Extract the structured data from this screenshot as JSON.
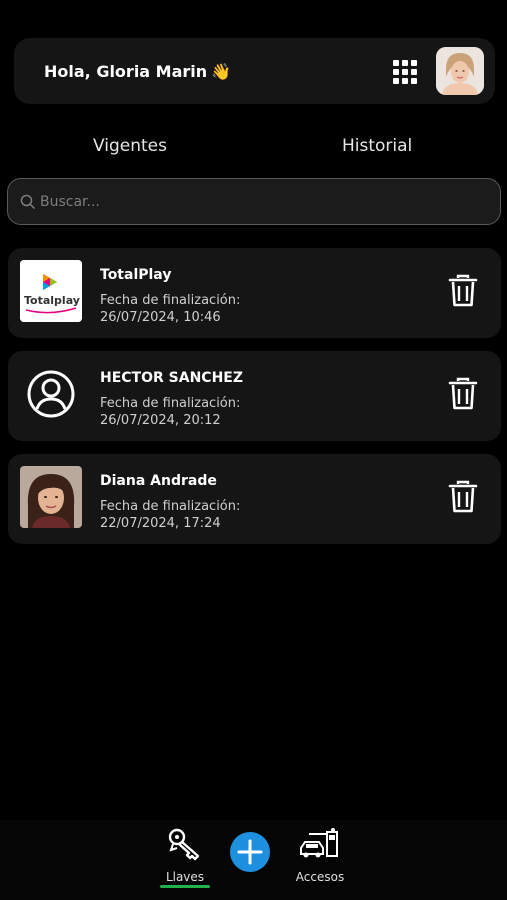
{
  "header": {
    "greeting": "Hola, Gloria Marin",
    "wave_emoji": "👋",
    "grid_icon": "apps-grid-icon",
    "avatar_icon": "user-avatar"
  },
  "tabs": [
    {
      "label": "Vigentes",
      "active": true
    },
    {
      "label": "Historial",
      "active": false
    }
  ],
  "search": {
    "placeholder": "Buscar..."
  },
  "items": [
    {
      "name": "TotalPlay",
      "label": "Fecha de finalización:",
      "date": "26/07/2024, 10:46",
      "thumb": "totalplay-logo"
    },
    {
      "name": "HECTOR SANCHEZ",
      "label": "Fecha de finalización:",
      "date": "26/07/2024, 20:12",
      "thumb": "user-circle-icon"
    },
    {
      "name": "Diana Andrade",
      "label": "Fecha de finalización:",
      "date": "22/07/2024, 17:24",
      "thumb": "photo-avatar"
    }
  ],
  "totalplay_text": "Totalplay",
  "nav": {
    "llaves_label": "Llaves",
    "accesos_label": "Accesos"
  },
  "colors": {
    "accent_blue": "#1f8fe0",
    "active_green": "#22b04a",
    "card_bg": "#151515"
  }
}
